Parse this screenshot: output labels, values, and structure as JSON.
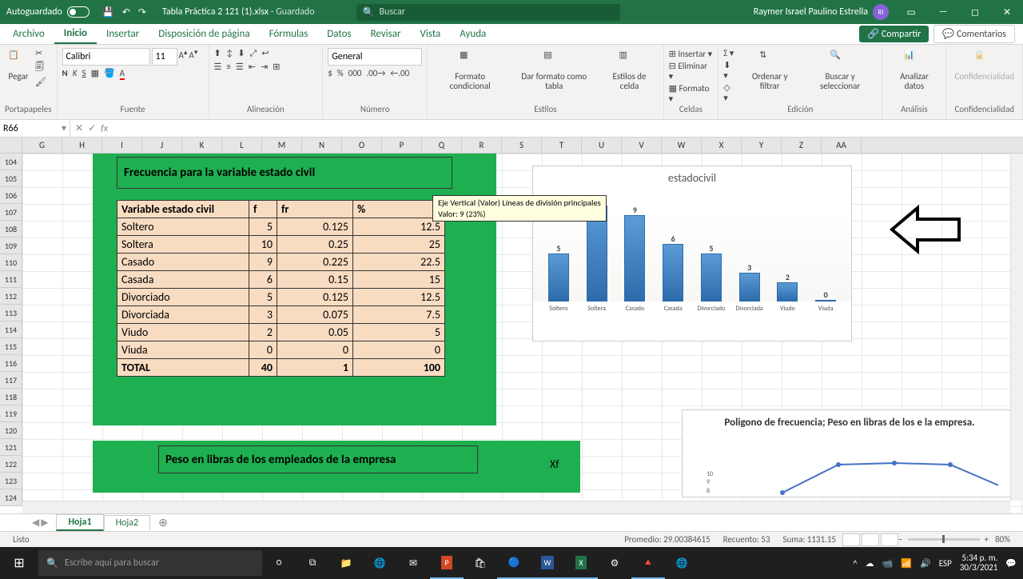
{
  "titlebar": {
    "autosave_label": "Autoguardado",
    "filename": "Tabla Práctica 2 121 (1).xlsx",
    "saved_suffix": " - Guardado",
    "search_placeholder": "Buscar",
    "user_name": "Raymer Israel Paulino Estrella",
    "user_initials": "RI"
  },
  "tabs": {
    "archivo": "Archivo",
    "inicio": "Inicio",
    "insertar": "Insertar",
    "disposicion": "Disposición de página",
    "formulas": "Fórmulas",
    "datos": "Datos",
    "revisar": "Revisar",
    "vista": "Vista",
    "ayuda": "Ayuda",
    "compartir": "Compartir",
    "comentarios": "Comentarios"
  },
  "ribbon": {
    "pegar": "Pegar",
    "portapapeles": "Portapapeles",
    "fuente": "Fuente",
    "font_name": "Calibri",
    "font_size": "11",
    "alineacion": "Alineación",
    "numero_group": "Número",
    "number_format": "General",
    "formato_cond": "Formato condicional",
    "dar_formato": "Dar formato como tabla",
    "estilos_celda": "Estilos de celda",
    "estilos": "Estilos",
    "insertar_btn": "Insertar",
    "eliminar_btn": "Eliminar",
    "formato_btn": "Formato",
    "celdas": "Celdas",
    "ordenar": "Ordenar y filtrar",
    "buscar": "Buscar y seleccionar",
    "edicion": "Edición",
    "analizar": "Analizar datos",
    "analisis": "Análisis",
    "confidencialidad": "Confidencialidad",
    "confidencialidad_grp": "Confidencialidad"
  },
  "namebox": "R66",
  "sheet": {
    "columns": [
      "G",
      "H",
      "I",
      "J",
      "K",
      "L",
      "M",
      "N",
      "O",
      "P",
      "Q",
      "R",
      "S",
      "T",
      "U",
      "V",
      "W",
      "X",
      "Y",
      "Z",
      "AA"
    ],
    "rows": [
      "104",
      "105",
      "106",
      "107",
      "108",
      "109",
      "110",
      "111",
      "112",
      "113",
      "114",
      "115",
      "116",
      "117",
      "118",
      "119",
      "120",
      "121",
      "122",
      "123",
      "124"
    ],
    "title1": "Frecuencia para la variable estado civil",
    "headers": {
      "c1": "Variable estado civil",
      "c2": "f",
      "c3": "fr",
      "c4": "%"
    },
    "data": [
      {
        "cat": "Soltero",
        "f": "5",
        "fr": "0.125",
        "pct": "12.5"
      },
      {
        "cat": "Soltera",
        "f": "10",
        "fr": "0.25",
        "pct": "25"
      },
      {
        "cat": "Casado",
        "f": "9",
        "fr": "0.225",
        "pct": "22.5"
      },
      {
        "cat": "Casada",
        "f": "6",
        "fr": "0.15",
        "pct": "15"
      },
      {
        "cat": "Divorciado",
        "f": "5",
        "fr": "0.125",
        "pct": "12.5"
      },
      {
        "cat": "Divorciada",
        "f": "3",
        "fr": "0.075",
        "pct": "7.5"
      },
      {
        "cat": "Viudo",
        "f": "2",
        "fr": "0.05",
        "pct": "5"
      },
      {
        "cat": "Viuda",
        "f": "0",
        "fr": "0",
        "pct": "0"
      }
    ],
    "total": {
      "label": "TOTAL",
      "f": "40",
      "fr": "1",
      "pct": "100"
    },
    "title2": "Peso en libras de los empleados de la empresa",
    "xf_label": "Xf"
  },
  "tooltip": {
    "line1": "Eje Vertical (Valor)  Líneas de división principales",
    "line2": "Valor: 9 (23%)"
  },
  "chart_data": {
    "type": "bar",
    "title": "estadocivil",
    "categories": [
      "Soltero",
      "Soltera",
      "Casado",
      "Casada",
      "Divorciado",
      "Divorciada",
      "Viudo",
      "Viuda"
    ],
    "values": [
      5,
      10,
      9,
      6,
      5,
      3,
      2,
      0
    ],
    "ylim": [
      0,
      10
    ]
  },
  "chart2": {
    "title": "Poligono de frecuencia; Peso en libras de los e la empresa.",
    "y_ticks": [
      "10",
      "9",
      "8"
    ]
  },
  "sheet_tabs": {
    "hoja1": "Hoja1",
    "hoja2": "Hoja2"
  },
  "status": {
    "listo": "Listo",
    "promedio": "Promedio: 29.00384615",
    "recuento": "Recuento: 53",
    "suma": "Suma: 1131.15",
    "zoom": "80%"
  },
  "taskbar": {
    "search_placeholder": "Escribe aquí para buscar",
    "lang": "ESP",
    "time": "5:34 p. m.",
    "date": "30/3/2021"
  }
}
